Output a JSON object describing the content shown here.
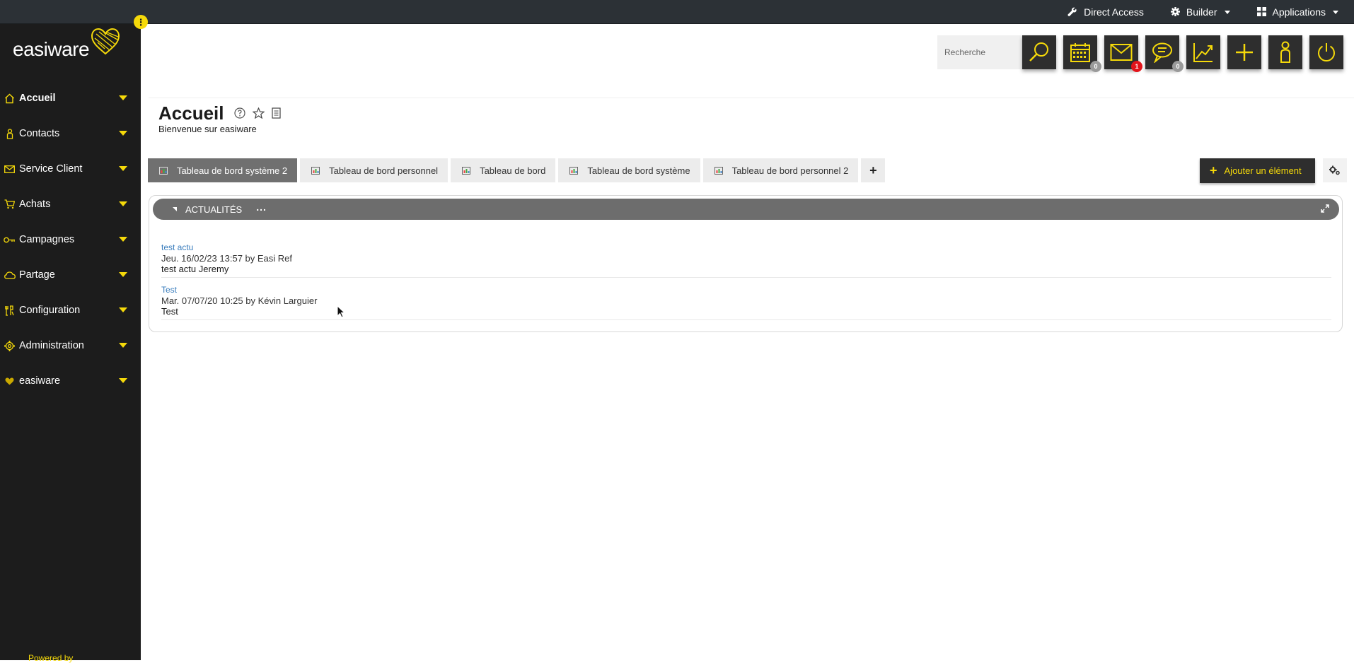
{
  "topbar": {
    "direct_access": "Direct Access",
    "builder": "Builder",
    "applications": "Applications"
  },
  "brand": {
    "logo_text": "easiware",
    "accent_color": "#f5d90a",
    "powered_by": "Powered by"
  },
  "sidebar": {
    "items": [
      {
        "label": "Accueil",
        "icon": "home-icon"
      },
      {
        "label": "Contacts",
        "icon": "person-icon"
      },
      {
        "label": "Service Client",
        "icon": "mail-icon"
      },
      {
        "label": "Achats",
        "icon": "cart-icon"
      },
      {
        "label": "Campagnes",
        "icon": "campaign-icon"
      },
      {
        "label": "Partage",
        "icon": "cloud-icon"
      },
      {
        "label": "Configuration",
        "icon": "tools-icon"
      },
      {
        "label": "Administration",
        "icon": "gear-icon"
      },
      {
        "label": "easiware",
        "icon": "heart-icon"
      }
    ]
  },
  "actions": {
    "search_placeholder": "Recherche",
    "calendar_badge": "0",
    "mail_badge": "1",
    "chat_badge": "0"
  },
  "header": {
    "title": "Accueil",
    "subtitle": "Bienvenue sur easiware"
  },
  "tabs": [
    {
      "label": "Tableau de bord système 2",
      "active": true
    },
    {
      "label": "Tableau de bord personnel",
      "active": false
    },
    {
      "label": "Tableau de bord",
      "active": false
    },
    {
      "label": "Tableau de bord système",
      "active": false
    },
    {
      "label": "Tableau de bord personnel 2",
      "active": false
    }
  ],
  "toolbar": {
    "add_tab": "+",
    "add_element": "Ajouter un élément",
    "add_element_plus": "+"
  },
  "widget": {
    "title": "ACTUALITÉS",
    "more": "...",
    "news": [
      {
        "link": "test actu",
        "meta": "Jeu. 16/02/23 13:57 by Easi Ref",
        "body": "test actu Jeremy"
      },
      {
        "link": "Test",
        "meta": "Mar. 07/07/20 10:25 by Kévin Larguier",
        "body": "Test"
      }
    ]
  }
}
